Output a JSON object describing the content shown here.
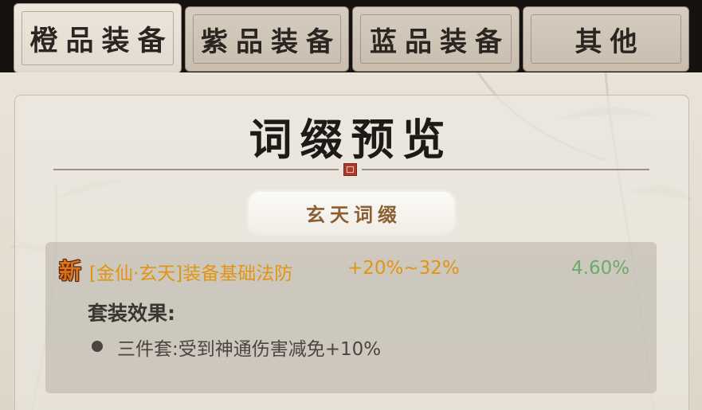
{
  "tabs": [
    {
      "label": "橙品装备",
      "active": true
    },
    {
      "label": "紫品装备",
      "active": false
    },
    {
      "label": "蓝品装备",
      "active": false
    },
    {
      "label": "其他",
      "active": false
    }
  ],
  "panel": {
    "title": "词缀预览",
    "subtitle": "玄天词缀"
  },
  "affix": {
    "badge": "新",
    "name": "[金仙·玄天]装备基础法防",
    "range": "+20%~32%",
    "rate": "4.60%",
    "set_heading": "套装效果:",
    "set_effect": "三件套:受到神通伤害减免+10%"
  },
  "colors": {
    "affix_text": "#e29412",
    "rate_text": "#6fa86a",
    "badge": "#d6741c",
    "seal": "#b03a2c"
  }
}
